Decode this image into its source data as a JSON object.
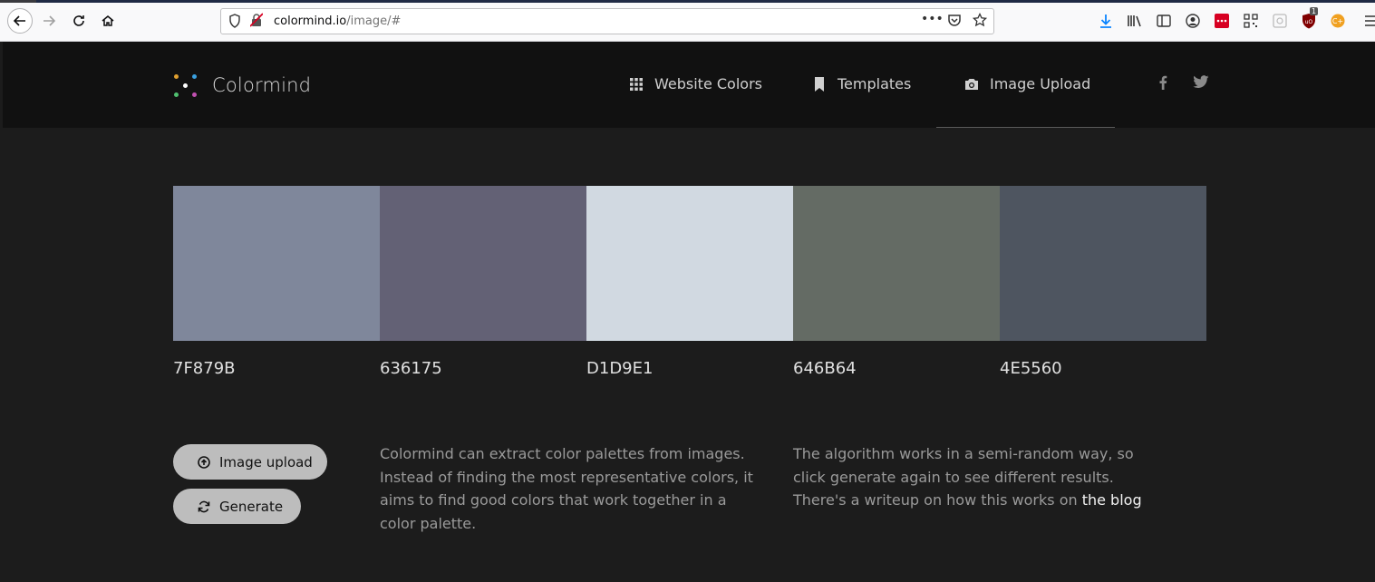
{
  "browser": {
    "url_host": "colormind.io",
    "url_path": "/image/#",
    "url_more": "•••",
    "download_badge": "1"
  },
  "site": {
    "brand": "Colormind",
    "nav": {
      "website_colors": "Website Colors",
      "templates": "Templates",
      "image_upload": "Image Upload"
    },
    "social": {
      "facebook": "f",
      "twitter": "t"
    }
  },
  "palette": {
    "swatches": [
      {
        "hex": "7F879B",
        "color": "#7F879B"
      },
      {
        "hex": "636175",
        "color": "#636175"
      },
      {
        "hex": "D1D9E1",
        "color": "#D1D9E1"
      },
      {
        "hex": "646B64",
        "color": "#646B64"
      },
      {
        "hex": "4E5560",
        "color": "#4E5560"
      }
    ]
  },
  "actions": {
    "image_upload": "Image upload",
    "generate": "Generate"
  },
  "description": {
    "p1": "Colormind can extract color palettes from images. Instead of finding the most representative colors, it aims to find good colors that work together in a color palette.",
    "p2_text": "The algorithm works in a semi-random way, so click generate again to see different results. There's a writeup on how this works on ",
    "p2_link": "the blog"
  }
}
